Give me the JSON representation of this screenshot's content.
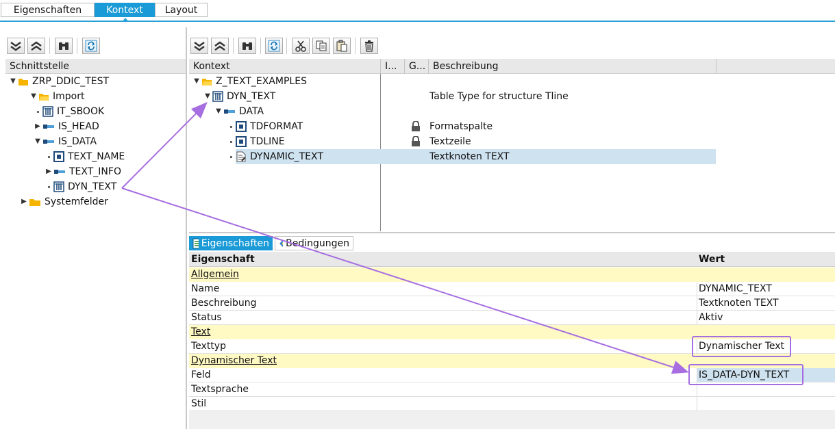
{
  "top_tabs": [
    "Eigenschaften",
    "Kontext",
    "Layout"
  ],
  "left_panel": {
    "header": "Schnittstelle",
    "tree": [
      {
        "label": "ZRP_DDIC_TEST"
      },
      {
        "label": "Import"
      },
      {
        "label": "IT_SBOOK"
      },
      {
        "label": "IS_HEAD"
      },
      {
        "label": "IS_DATA"
      },
      {
        "label": "TEXT_NAME"
      },
      {
        "label": "TEXT_INFO"
      },
      {
        "label": "DYN_TEXT"
      },
      {
        "label": "Systemfelder"
      }
    ]
  },
  "context_panel": {
    "columns": [
      "Kontext",
      "I...",
      "G...",
      "Beschreibung"
    ],
    "rows": [
      {
        "label": "Z_TEXT_EXAMPLES",
        "description": ""
      },
      {
        "label": "DYN_TEXT",
        "description": "Table Type for structure Tline"
      },
      {
        "label": "DATA",
        "description": ""
      },
      {
        "label": "TDFORMAT",
        "description": "Formatspalte"
      },
      {
        "label": "TDLINE",
        "description": "Textzeile"
      },
      {
        "label": "DYNAMIC_TEXT",
        "description": "Textknoten TEXT"
      }
    ]
  },
  "properties": {
    "tabs": [
      "Eigenschaften",
      "Bedingungen"
    ],
    "columns": [
      "Eigenschaft",
      "Wert"
    ],
    "rows": [
      {
        "key": "Allgemein",
        "value": ""
      },
      {
        "key": "Name",
        "value": "DYNAMIC_TEXT"
      },
      {
        "key": "Beschreibung",
        "value": "Textknoten TEXT"
      },
      {
        "key": "Status",
        "value": "Aktiv"
      },
      {
        "key": "Text",
        "value": ""
      },
      {
        "key": "Texttyp",
        "value": "Dynamischer Text"
      },
      {
        "key": "Dynamischer Text",
        "value": ""
      },
      {
        "key": "Feld",
        "value": "IS_DATA-DYN_TEXT"
      },
      {
        "key": "Textsprache",
        "value": ""
      },
      {
        "key": "Stil",
        "value": ""
      }
    ]
  },
  "icons": {
    "toolbar": [
      "expand-all-icon",
      "collapse-all-icon",
      "find-icon",
      "refresh-icon",
      "cut-icon",
      "copy-icon",
      "paste-icon",
      "delete-icon"
    ],
    "tree": [
      "folder-icon",
      "table-icon",
      "structure-icon",
      "field-icon",
      "text-node-icon",
      "lock-icon"
    ]
  },
  "colors": {
    "accent": "#1a9ad6",
    "selection": "#cfe2f0",
    "group_row": "#fff9c4",
    "annotation": "#a66ee0"
  }
}
